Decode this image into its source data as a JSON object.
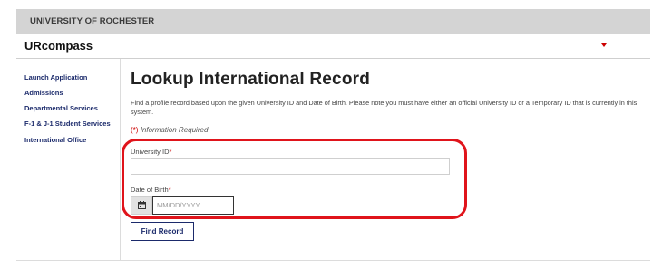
{
  "header": {
    "university": "UNIVERSITY OF ROCHESTER",
    "app_name": "URcompass"
  },
  "sidebar": {
    "items": [
      {
        "label": "Launch Application"
      },
      {
        "label": "Admissions"
      },
      {
        "label": "Departmental Services"
      },
      {
        "label": "F-1 & J-1 Student Services"
      },
      {
        "label": "International Office"
      }
    ]
  },
  "main": {
    "title": "Lookup International Record",
    "description": "Find a profile record based upon the given University ID and Date of Birth. Please note you must have either an official University ID or a Temporary ID that is currently in this system.",
    "required_note_star": "(*)",
    "required_note_text": "Information Required",
    "university_id": {
      "label": "University ID",
      "value": ""
    },
    "dob": {
      "label": "Date of Birth",
      "placeholder": "MM/DD/YYYY",
      "value": ""
    },
    "find_button": "Find Record"
  },
  "colors": {
    "accent": "#1b2a6b",
    "required": "#c00000",
    "highlight": "#e0141b",
    "topbar": "#d4d4d4"
  },
  "icons": {
    "calendar": "calendar-icon",
    "dropdown": "chevron-down-icon"
  }
}
